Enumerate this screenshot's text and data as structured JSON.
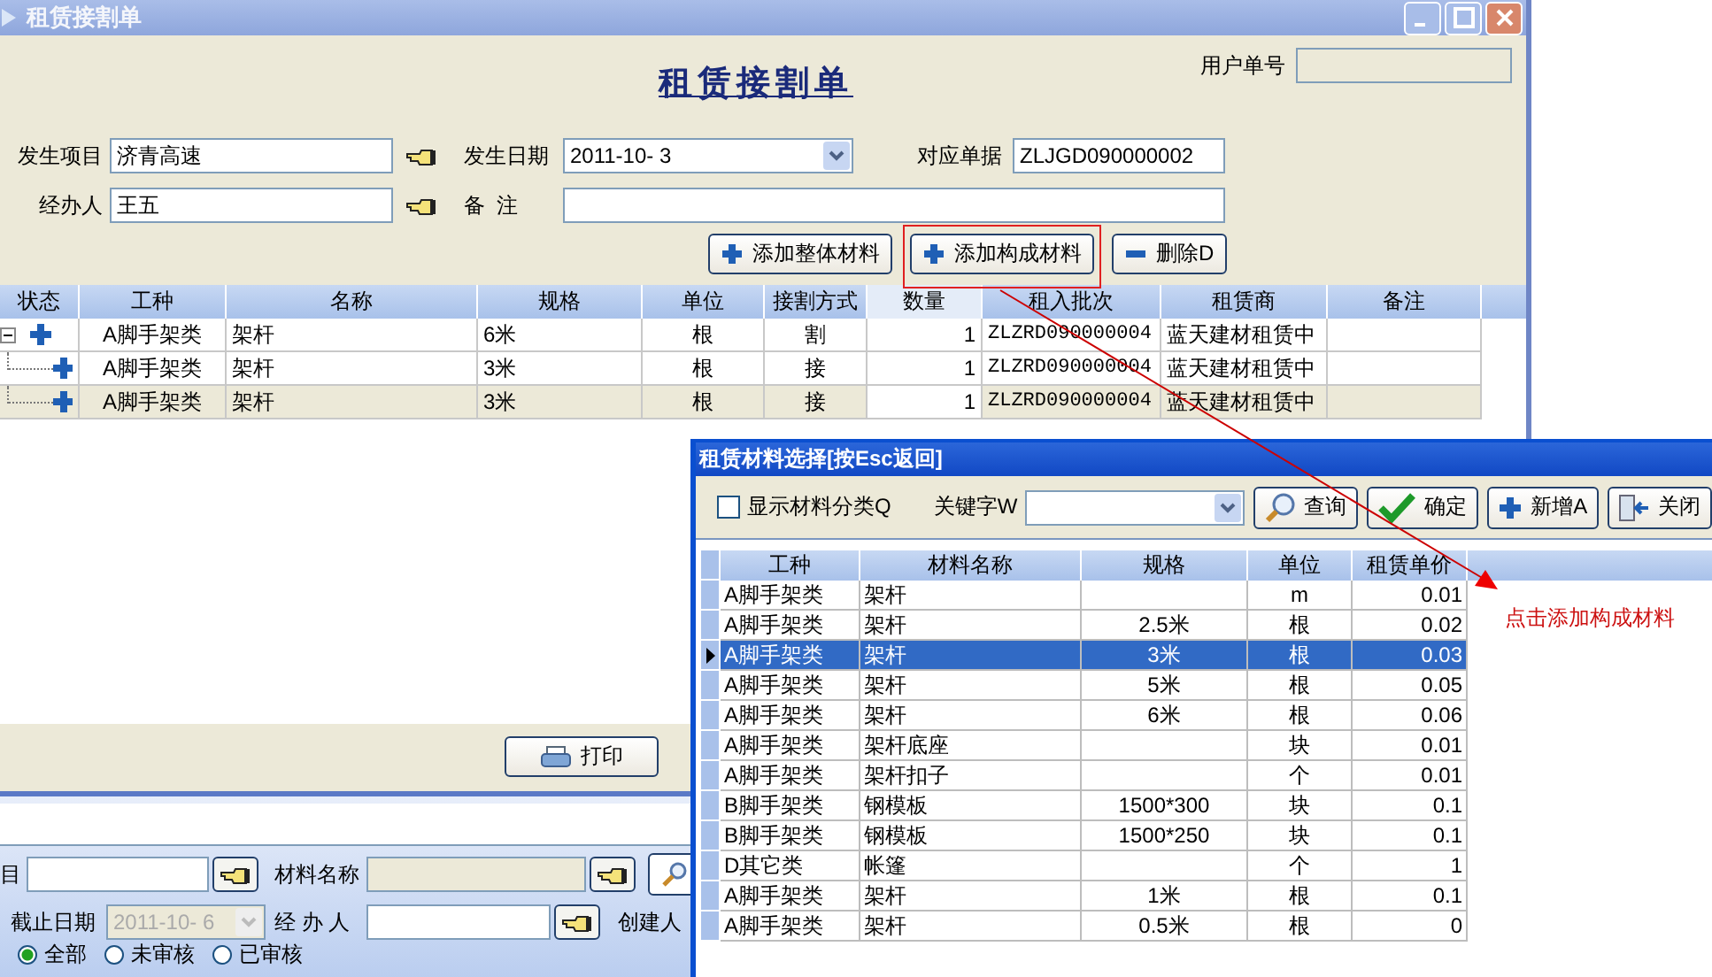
{
  "main_window": {
    "title": "租赁接割单",
    "header_title": "租赁接割单",
    "user_no": {
      "label": "用户单号"
    },
    "form": {
      "project": {
        "label": "发生项目",
        "value": "济青高速"
      },
      "date": {
        "label": "发生日期",
        "value": "2011-10- 3"
      },
      "document": {
        "label": "对应单据",
        "value": "ZLJGD090000002"
      },
      "handler": {
        "label": "经办人",
        "value": "王五"
      },
      "remark": {
        "label": "备  注"
      }
    },
    "buttons": [
      {
        "label": "添加整体材料",
        "kind": "plus"
      },
      {
        "label": "添加构成材料",
        "kind": "plus"
      },
      {
        "label": "删除D",
        "kind": "minus"
      }
    ],
    "grid": {
      "columns": [
        "状态",
        "工种",
        "名称",
        "规格",
        "单位",
        "接割方式",
        "数量",
        "租入批次",
        "租赁商",
        "备注"
      ],
      "rows": [
        {
          "work_type": "A脚手架类",
          "name": "架杆",
          "spec": "6米",
          "unit": "根",
          "method": "割",
          "quantity": "1",
          "batch": "ZLZRD090000004",
          "supplier": "蓝天建材租赁中",
          "selected": false,
          "expanded": true,
          "children": [
            {
              "work_type": "A脚手架类",
              "name": "架杆",
              "spec": "3米",
              "unit": "根",
              "method": "接",
              "quantity": "1",
              "batch": "ZLZRD090000004",
              "supplier": "蓝天建材租赁中",
              "selected": false
            },
            {
              "work_type": "A脚手架类",
              "name": "架杆",
              "spec": "3米",
              "unit": "根",
              "method": "接",
              "quantity": "1",
              "batch": "ZLZRD090000004",
              "supplier": "蓝天建材租赁中",
              "selected": true
            }
          ]
        }
      ]
    },
    "print_button": "打印"
  },
  "query_window": {
    "project_label": "目",
    "material_label": "材料名称",
    "end_date": {
      "label": "截止日期",
      "value": "2011-10- 6",
      "disabled": true
    },
    "handler_label": "经 办 人",
    "creator_label": "创建人",
    "radios": [
      {
        "label": "全部",
        "selected": true
      },
      {
        "label": "未审核",
        "selected": false
      },
      {
        "label": "已审核",
        "selected": false
      }
    ]
  },
  "dialog": {
    "title": "租赁材料选择[按Esc返回]",
    "show_category": {
      "label": "显示材料分类Q",
      "checked": false
    },
    "keyword_label": "关键字W",
    "buttons": [
      {
        "label": "查询",
        "kind": "search"
      },
      {
        "label": "确定",
        "kind": "check"
      },
      {
        "label": "新增A",
        "kind": "plus"
      },
      {
        "label": "关闭",
        "kind": "exit"
      }
    ],
    "grid": {
      "columns": [
        "工种",
        "材料名称",
        "规格",
        "单位",
        "租赁单价"
      ],
      "rows": [
        {
          "work_type": "A脚手架类",
          "name": "架杆",
          "unit": "m",
          "price": "0.01",
          "selected": false
        },
        {
          "work_type": "A脚手架类",
          "name": "架杆",
          "spec": "2.5米",
          "unit": "根",
          "price": "0.02",
          "selected": false
        },
        {
          "work_type": "A脚手架类",
          "name": "架杆",
          "spec": "3米",
          "unit": "根",
          "price": "0.03",
          "selected": true
        },
        {
          "work_type": "A脚手架类",
          "name": "架杆",
          "spec": "5米",
          "unit": "根",
          "price": "0.05",
          "selected": false
        },
        {
          "work_type": "A脚手架类",
          "name": "架杆",
          "spec": "6米",
          "unit": "根",
          "price": "0.06",
          "selected": false
        },
        {
          "work_type": "A脚手架类",
          "name": "架杆底座",
          "unit": "块",
          "price": "0.01",
          "selected": false
        },
        {
          "work_type": "A脚手架类",
          "name": "架杆扣子",
          "unit": "个",
          "price": "0.01",
          "selected": false
        },
        {
          "work_type": "B脚手架类",
          "name": "钢模板",
          "spec": "1500*300",
          "unit": "块",
          "price": "0.1",
          "selected": false
        },
        {
          "work_type": "B脚手架类",
          "name": "钢模板",
          "spec": "1500*250",
          "unit": "块",
          "price": "0.1",
          "selected": false
        },
        {
          "work_type": "D其它类",
          "name": "帐篷",
          "unit": "个",
          "price": "1",
          "selected": false
        },
        {
          "work_type": "A脚手架类",
          "name": "架杆",
          "spec": "1米",
          "unit": "根",
          "price": "0.1",
          "selected": false
        },
        {
          "work_type": "A脚手架类",
          "name": "架杆",
          "spec": "0.5米",
          "unit": "根",
          "price": "0",
          "selected": false
        }
      ]
    }
  },
  "annotation": {
    "text": "点击添加构成材料"
  }
}
